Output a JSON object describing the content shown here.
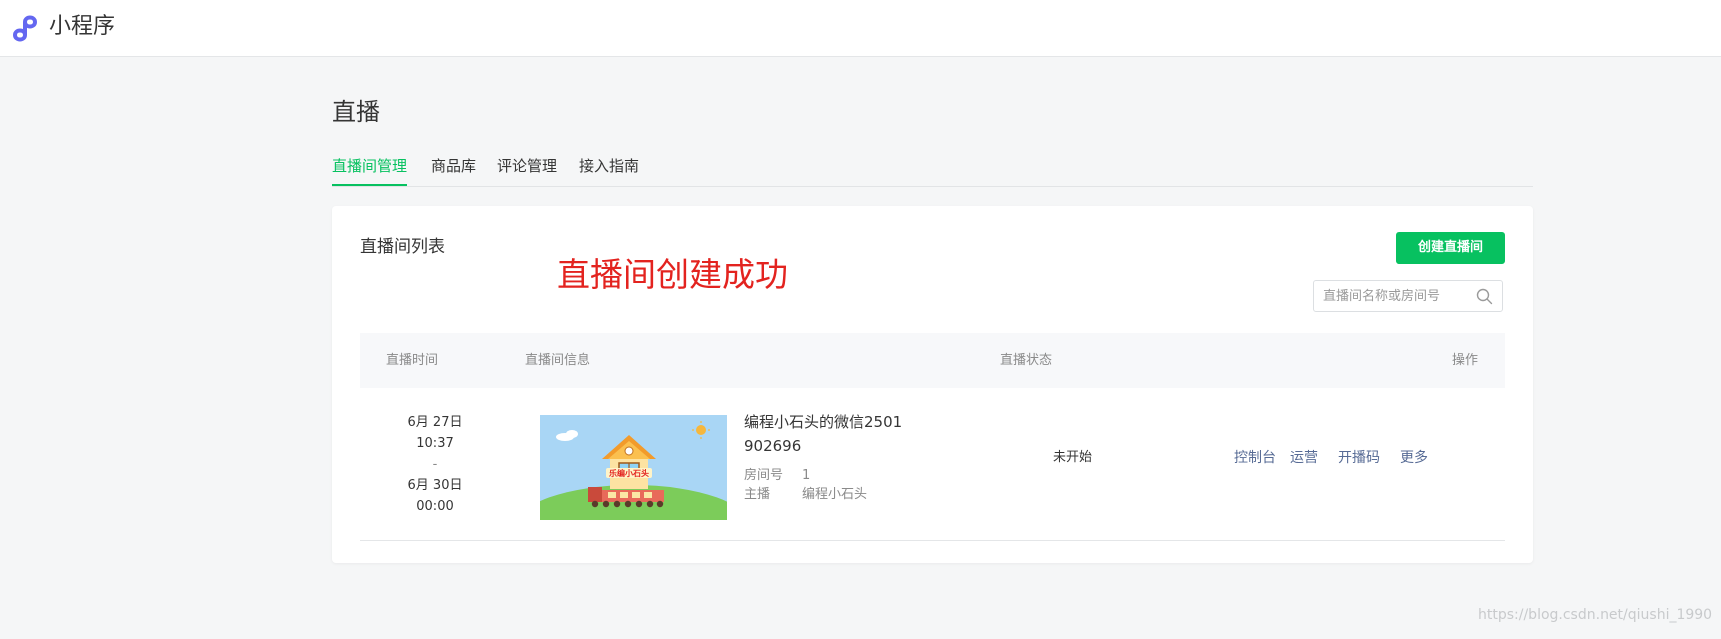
{
  "header": {
    "app_name": "小程序",
    "logo_icon": "miniprogram-logo-icon",
    "accent": "#6467f0"
  },
  "page": {
    "title": "直播"
  },
  "tabs": [
    {
      "label": "直播间管理",
      "active": true
    },
    {
      "label": "商品库",
      "active": false
    },
    {
      "label": "评论管理",
      "active": false
    },
    {
      "label": "接入指南",
      "active": false
    }
  ],
  "card": {
    "title": "直播间列表",
    "success_message": "直播间创建成功",
    "create_button": "创建直播间",
    "search": {
      "placeholder": "直播间名称或房间号",
      "value": "",
      "icon": "search-icon"
    }
  },
  "table": {
    "headers": {
      "time": "直播时间",
      "info": "直播间信息",
      "status": "直播状态",
      "actions": "操作"
    },
    "rows": [
      {
        "start_date": "6月 27日",
        "start_time": "10:37",
        "separator": "-",
        "end_date": "6月 30日",
        "end_time": "00:00",
        "thumbnail_text": "乐编小石头",
        "name": "编程小石头的微信2501902696",
        "room_label": "房间号",
        "room_no": "1",
        "anchor_label": "主播",
        "anchor": "编程小石头",
        "status": "未开始",
        "actions": [
          "控制台",
          "运营",
          "开播码",
          "更多"
        ]
      }
    ]
  },
  "watermark": "https://blog.csdn.net/qiushi_1990",
  "colors": {
    "primary": "#07c160",
    "link": "#576b95",
    "success_text": "#e3231f"
  }
}
